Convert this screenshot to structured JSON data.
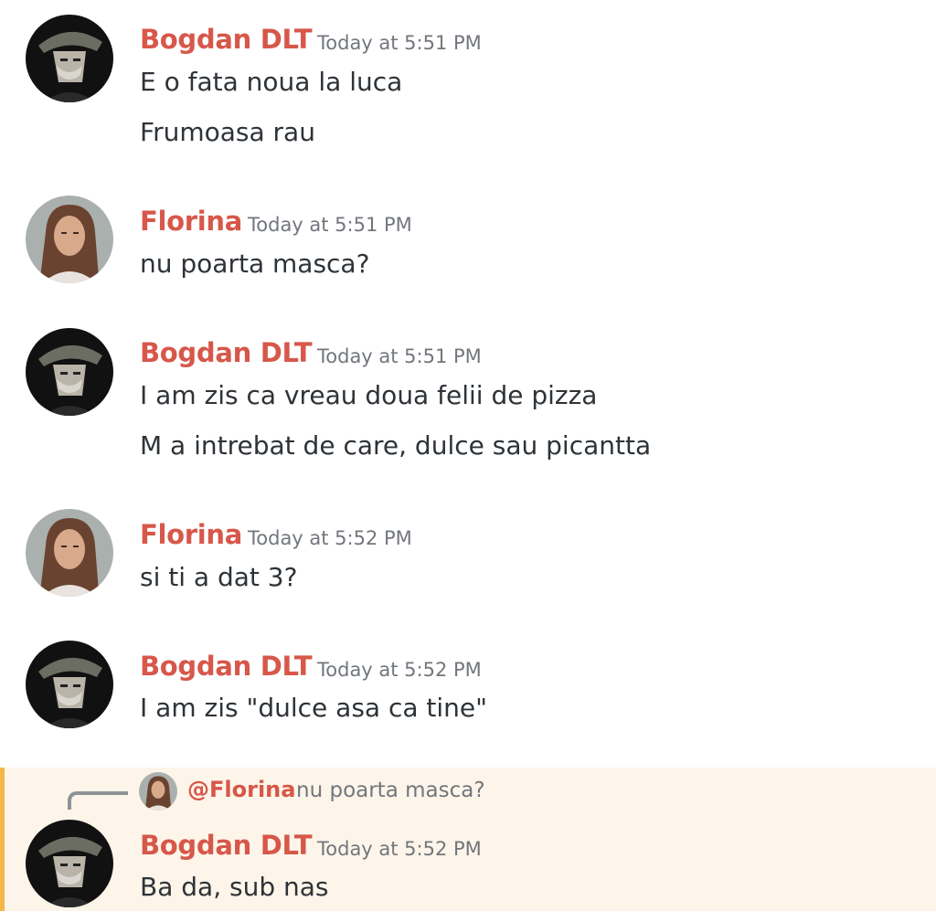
{
  "colors": {
    "username": "#d7574a",
    "timestamp": "#72767d",
    "message_text": "#2e3338",
    "highlight_bg": "#fdf5e9",
    "highlight_bar": "#f6b64a"
  },
  "messages": [
    {
      "author": "Bogdan DLT",
      "time": "Today at 5:51 PM",
      "avatar": "bogdan-avatar",
      "lines": [
        "E o fata noua la luca",
        "Frumoasa rau"
      ]
    },
    {
      "author": "Florina",
      "time": "Today at 5:51 PM",
      "avatar": "florina-avatar",
      "lines": [
        "nu poarta masca?"
      ]
    },
    {
      "author": "Bogdan DLT",
      "time": "Today at 5:51 PM",
      "avatar": "bogdan-avatar",
      "lines": [
        "I am zis ca vreau doua felii de pizza",
        "M a intrebat de care, dulce sau picantta"
      ]
    },
    {
      "author": "Florina",
      "time": "Today at 5:52 PM",
      "avatar": "florina-avatar",
      "lines": [
        "si ti a dat 3?"
      ]
    },
    {
      "author": "Bogdan DLT",
      "time": "Today at 5:52 PM",
      "avatar": "bogdan-avatar",
      "lines": [
        "I am zis \"dulce asa ca tine\""
      ]
    },
    {
      "author": "Bogdan DLT",
      "time": "Today at 5:52 PM",
      "avatar": "bogdan-avatar",
      "lines": [
        "Ba da, sub nas"
      ],
      "reply": {
        "mention": "@Florina",
        "quoted_text": "nu poarta masca?",
        "avatar": "florina-avatar"
      }
    }
  ]
}
